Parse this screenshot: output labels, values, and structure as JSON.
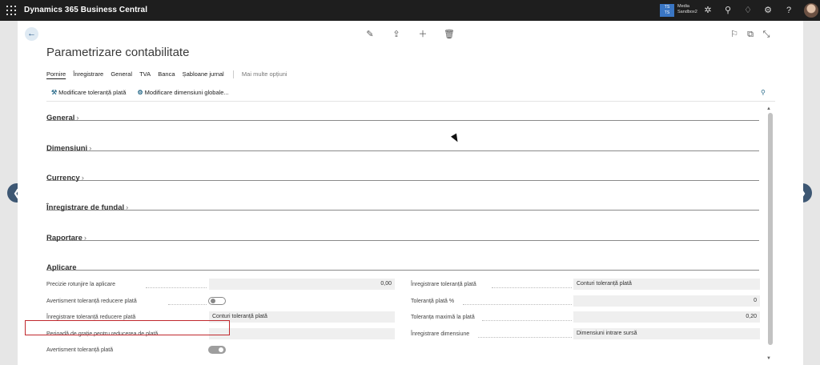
{
  "topbar": {
    "app_title": "Dynamics 365 Business Central",
    "env_badge": "TS\nTS",
    "env_company": "Media",
    "env_name": "Sandbox2",
    "icons": [
      "waffle-icon",
      "copilot-icon",
      "search-icon",
      "bell-icon",
      "gear-icon",
      "help-icon",
      "avatar"
    ]
  },
  "page": {
    "title": "Parametrizare contabilitate",
    "actions": [
      "Pornire",
      "Înregistrare",
      "General",
      "TVA",
      "Banca",
      "Șabloane jurnal"
    ],
    "more_options": "Mai multe opțiuni",
    "toolbar": {
      "btn1": "Modificare toleranță plată",
      "btn2": "Modificare dimensiuni globale..."
    },
    "sections": [
      "General",
      "Dimensiuni",
      "Currency",
      "Înregistrare de fundal",
      "Raportare",
      "Aplicare"
    ]
  },
  "aplicare": {
    "left": [
      {
        "label": "Precizie rotunjire la aplicare",
        "value": "0,00",
        "type": "number"
      },
      {
        "label": "Avertisment toleranță reducere plată",
        "value": "",
        "type": "toggle",
        "on": false
      },
      {
        "label": "Înregistrare toleranță reducere plată",
        "value": "Conturi toleranță plată",
        "type": "text"
      },
      {
        "label": "Perioadă de grație pentru reducerea de plată",
        "value": "",
        "type": "text"
      },
      {
        "label": "Avertisment toleranță plată",
        "value": "",
        "type": "toggle",
        "on": true
      }
    ],
    "right": [
      {
        "label": "Înregistrare toleranță plată",
        "value": "Conturi toleranță plată",
        "type": "text"
      },
      {
        "label": "Toleranță plată %",
        "value": "0",
        "type": "number"
      },
      {
        "label": "Toleranța maximă la plată",
        "value": "0,20",
        "type": "number"
      },
      {
        "label": "Înregistrare dimensiune",
        "value": "Dimensiuni intrare sursă",
        "type": "text"
      }
    ]
  },
  "colors": {
    "topbar": "#1e1e1e",
    "highlight": "#c0282d",
    "nav_button": "#3d5773"
  }
}
